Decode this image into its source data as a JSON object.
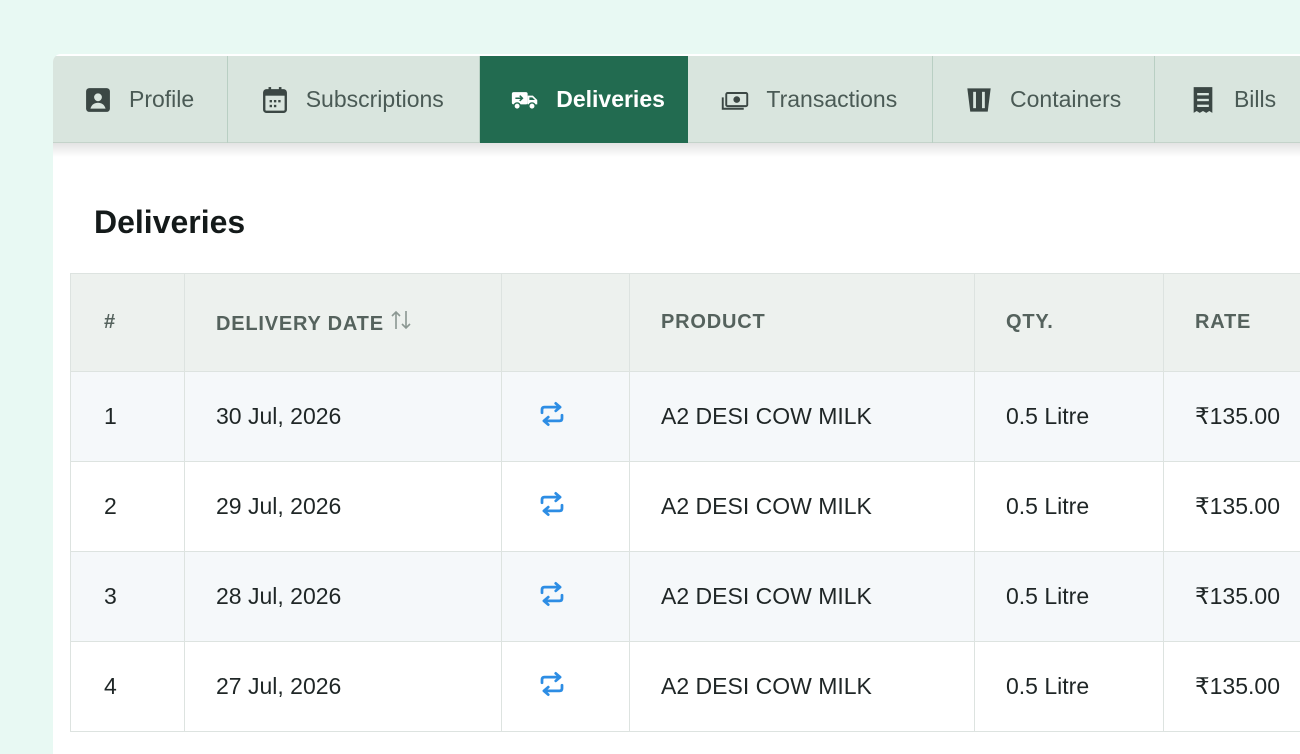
{
  "tabs": [
    {
      "label": "Profile",
      "icon": "profile-icon",
      "active": false
    },
    {
      "label": "Subscriptions",
      "icon": "calendar-icon",
      "active": false
    },
    {
      "label": "Deliveries",
      "icon": "delivery-truck-icon",
      "active": true
    },
    {
      "label": "Transactions",
      "icon": "money-icon",
      "active": false
    },
    {
      "label": "Containers",
      "icon": "container-icon",
      "active": false
    },
    {
      "label": "Bills",
      "icon": "receipt-icon",
      "active": false
    }
  ],
  "section": {
    "title": "Deliveries"
  },
  "table": {
    "headers": [
      "#",
      "DELIVERY DATE",
      "",
      "PRODUCT",
      "QTY.",
      "RATE"
    ],
    "sort_icon": "sort-icon",
    "row_icon": "repeat-icon",
    "rows": [
      {
        "num": "1",
        "date": "30 Jul, 2026",
        "product": "A2 DESI COW MILK",
        "qty": "0.5 Litre",
        "rate": "₹135.00"
      },
      {
        "num": "2",
        "date": "29 Jul, 2026",
        "product": "A2 DESI COW MILK",
        "qty": "0.5 Litre",
        "rate": "₹135.00"
      },
      {
        "num": "3",
        "date": "28 Jul, 2026",
        "product": "A2 DESI COW MILK",
        "qty": "0.5 Litre",
        "rate": "₹135.00"
      },
      {
        "num": "4",
        "date": "27 Jul, 2026",
        "product": "A2 DESI COW MILK",
        "qty": "0.5 Litre",
        "rate": "₹135.00"
      }
    ]
  },
  "colors": {
    "page_bg": "#e8f9f3",
    "tab_bar": "#d9e5de",
    "active_tab": "#226b50",
    "repeat_icon": "#2d8de4"
  }
}
